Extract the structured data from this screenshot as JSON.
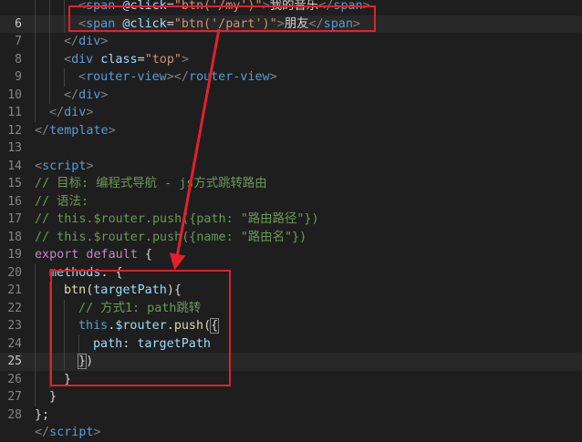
{
  "editor": {
    "lines": [
      {
        "n": "",
        "indent": 3,
        "tokens": [
          {
            "t": "<",
            "c": "punc"
          },
          {
            "t": "span",
            "c": "tag"
          },
          {
            "t": " @click",
            "c": "attr"
          },
          {
            "t": "=",
            "c": "op"
          },
          {
            "t": "\"btn('/my')\"",
            "c": "str"
          },
          {
            "t": ">",
            "c": "punc"
          },
          {
            "t": "我的音乐",
            "c": "text"
          },
          {
            "t": "</",
            "c": "punc"
          },
          {
            "t": "span",
            "c": "tag"
          },
          {
            "t": ">",
            "c": "punc"
          }
        ]
      },
      {
        "n": "6",
        "indent": 3,
        "current": true,
        "tokens": [
          {
            "t": "<",
            "c": "punc"
          },
          {
            "t": "span",
            "c": "tag"
          },
          {
            "t": " @click",
            "c": "attr"
          },
          {
            "t": "=",
            "c": "op"
          },
          {
            "t": "\"btn('/part')\"",
            "c": "str"
          },
          {
            "t": ">",
            "c": "punc"
          },
          {
            "t": "朋友",
            "c": "text"
          },
          {
            "t": "</",
            "c": "punc"
          },
          {
            "t": "span",
            "c": "tag"
          },
          {
            "t": ">",
            "c": "punc"
          }
        ]
      },
      {
        "n": "7",
        "indent": 2,
        "tokens": [
          {
            "t": "</",
            "c": "punc"
          },
          {
            "t": "div",
            "c": "tag"
          },
          {
            "t": ">",
            "c": "punc"
          }
        ]
      },
      {
        "n": "8",
        "indent": 2,
        "tokens": [
          {
            "t": "<",
            "c": "punc"
          },
          {
            "t": "div",
            "c": "tag"
          },
          {
            "t": " class",
            "c": "attr"
          },
          {
            "t": "=",
            "c": "op"
          },
          {
            "t": "\"top\"",
            "c": "str"
          },
          {
            "t": ">",
            "c": "punc"
          }
        ]
      },
      {
        "n": "9",
        "indent": 3,
        "tokens": [
          {
            "t": "<",
            "c": "punc"
          },
          {
            "t": "router-view",
            "c": "tag"
          },
          {
            "t": "></",
            "c": "punc"
          },
          {
            "t": "router-view",
            "c": "tag"
          },
          {
            "t": ">",
            "c": "punc"
          }
        ]
      },
      {
        "n": "10",
        "indent": 2,
        "tokens": [
          {
            "t": "</",
            "c": "punc"
          },
          {
            "t": "div",
            "c": "tag"
          },
          {
            "t": ">",
            "c": "punc"
          }
        ]
      },
      {
        "n": "11",
        "indent": 1,
        "tokens": [
          {
            "t": "</",
            "c": "punc"
          },
          {
            "t": "div",
            "c": "tag"
          },
          {
            "t": ">",
            "c": "punc"
          }
        ]
      },
      {
        "n": "12",
        "indent": 0,
        "tokens": [
          {
            "t": "</",
            "c": "punc"
          },
          {
            "t": "template",
            "c": "tag"
          },
          {
            "t": ">",
            "c": "punc"
          }
        ]
      },
      {
        "n": "13",
        "indent": 0,
        "tokens": []
      },
      {
        "n": "14",
        "indent": 0,
        "tokens": [
          {
            "t": "<",
            "c": "punc"
          },
          {
            "t": "script",
            "c": "tag"
          },
          {
            "t": ">",
            "c": "punc"
          }
        ]
      },
      {
        "n": "15",
        "indent": 0,
        "tokens": [
          {
            "t": "// 目标: 编程式导航 - js方式跳转路由",
            "c": "cmt"
          }
        ]
      },
      {
        "n": "16",
        "indent": 0,
        "tokens": [
          {
            "t": "// 语法:",
            "c": "cmt"
          }
        ]
      },
      {
        "n": "17",
        "indent": 0,
        "tokens": [
          {
            "t": "// this.$router.push({path: \"路由路径\"})",
            "c": "cmt"
          }
        ]
      },
      {
        "n": "18",
        "indent": 0,
        "tokens": [
          {
            "t": "// this.$router.push({name: \"路由名\"})",
            "c": "cmt"
          }
        ]
      },
      {
        "n": "19",
        "indent": 0,
        "tokens": [
          {
            "t": "export default",
            "c": "kw"
          },
          {
            "t": " {",
            "c": "op"
          }
        ]
      },
      {
        "n": "20",
        "indent": 1,
        "tokens": [
          {
            "t": "methods",
            "c": "var"
          },
          {
            "t": ": {",
            "c": "op"
          }
        ]
      },
      {
        "n": "21",
        "indent": 2,
        "tokens": [
          {
            "t": "btn",
            "c": "fn"
          },
          {
            "t": "(",
            "c": "op"
          },
          {
            "t": "targetPath",
            "c": "var"
          },
          {
            "t": "){",
            "c": "op"
          }
        ]
      },
      {
        "n": "22",
        "indent": 3,
        "tokens": [
          {
            "t": "// 方式1: path跳转",
            "c": "cmt"
          }
        ]
      },
      {
        "n": "23",
        "indent": 3,
        "tokens": [
          {
            "t": "this",
            "c": "this"
          },
          {
            "t": ".",
            "c": "op"
          },
          {
            "t": "$router",
            "c": "var"
          },
          {
            "t": ".",
            "c": "op"
          },
          {
            "t": "push",
            "c": "fn"
          },
          {
            "t": "(",
            "c": "op"
          },
          {
            "t": "{",
            "c": "op",
            "hl": true
          }
        ]
      },
      {
        "n": "24",
        "indent": 4,
        "tokens": [
          {
            "t": "path",
            "c": "var"
          },
          {
            "t": ": ",
            "c": "op"
          },
          {
            "t": "targetPath",
            "c": "var"
          }
        ]
      },
      {
        "n": "25",
        "indent": 3,
        "current": true,
        "tokens": [
          {
            "t": "}",
            "c": "op",
            "hl": true
          },
          {
            "t": ")",
            "c": "op"
          }
        ]
      },
      {
        "n": "26",
        "indent": 2,
        "tokens": [
          {
            "t": "}",
            "c": "op"
          }
        ]
      },
      {
        "n": "27",
        "indent": 1,
        "tokens": [
          {
            "t": "}",
            "c": "op"
          }
        ]
      },
      {
        "n": "28",
        "indent": 0,
        "tokens": [
          {
            "t": "};",
            "c": "op"
          }
        ]
      },
      {
        "n": "",
        "indent": 0,
        "tokens": [
          {
            "t": "</",
            "c": "punc"
          },
          {
            "t": "script",
            "c": "tag"
          },
          {
            "t": ">",
            "c": "punc"
          }
        ]
      }
    ]
  },
  "annotation": {
    "color": "#e3202b",
    "from": "span-click-line",
    "to": "btn-method-block"
  }
}
